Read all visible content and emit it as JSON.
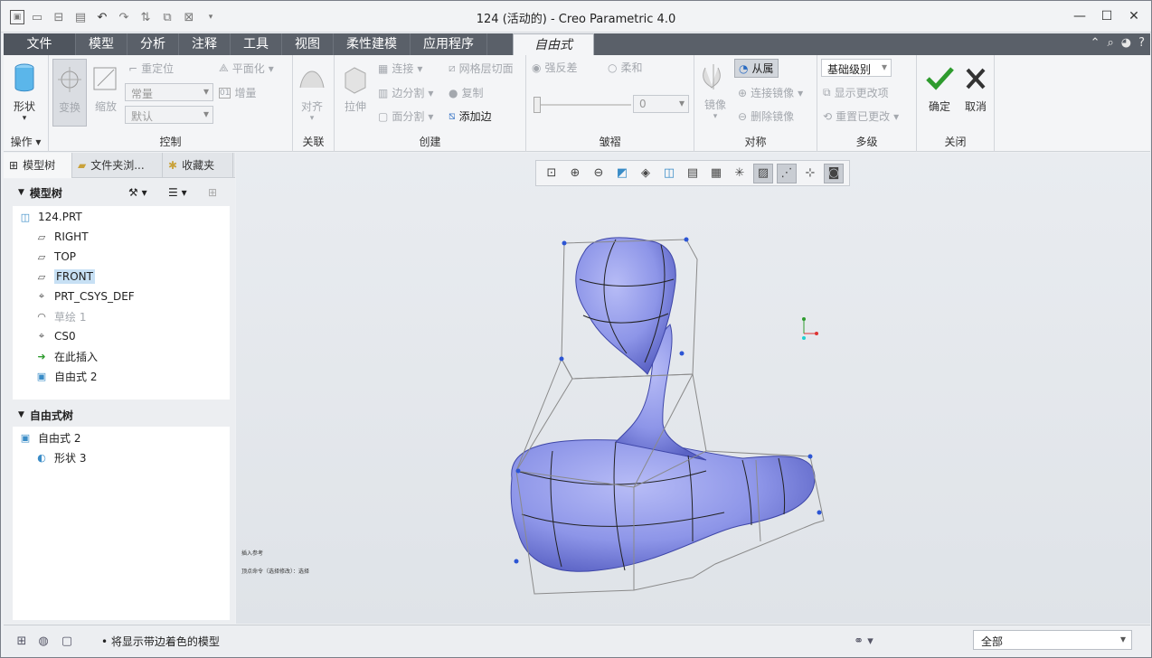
{
  "window": {
    "title": "124 (活动的) - Creo Parametric 4.0"
  },
  "menu_tabs": [
    "文件",
    "模型",
    "分析",
    "注释",
    "工具",
    "视图",
    "柔性建模",
    "应用程序"
  ],
  "active_tab": "自由式",
  "ribbon": {
    "operations": {
      "shape": "形状",
      "label": "操作"
    },
    "control": {
      "transform": "变换",
      "scale": "缩放",
      "reposition": "重定位",
      "planarize": "平面化",
      "increment": "增量",
      "combo1": "常量",
      "combo2": "默认",
      "label": "控制"
    },
    "assoc": {
      "align": "对齐",
      "label": "关联"
    },
    "create": {
      "extrude": "拉伸",
      "connect": "连接",
      "mesh_slice": "网格层切面",
      "edge_split": "边分割",
      "copy": "复制",
      "face_split": "面分割",
      "add_edge": "添加边",
      "label": "创建"
    },
    "crease": {
      "strong": "强反差",
      "soft": "柔和",
      "value": "0",
      "label": "皱褶"
    },
    "symmetry": {
      "mirror": "镜像",
      "follow": "从属",
      "connect_mirror": "连接镜像",
      "delete_mirror": "删除镜像",
      "label": "对称"
    },
    "multilevel": {
      "base": "基础级别",
      "show_changes": "显示更改项",
      "reset_changes": "重置已更改",
      "label": "多级"
    },
    "close": {
      "ok": "确定",
      "cancel": "取消",
      "label": "关闭"
    }
  },
  "panel_tabs": [
    "模型树",
    "文件夹浏...",
    "收藏夹"
  ],
  "model_tree": {
    "header": "模型树",
    "items": [
      "124.PRT",
      "RIGHT",
      "TOP",
      "FRONT",
      "PRT_CSYS_DEF",
      "草绘 1",
      "CS0",
      "在此插入",
      "自由式 2"
    ]
  },
  "freestyle_tree": {
    "header": "自由式树",
    "items": [
      "自由式 2",
      "形状 3"
    ]
  },
  "graphics_notes": [
    "插入参考",
    "顶点命令（选择修改）：选择"
  ],
  "status": {
    "message": "将显示带边着色的模型",
    "filter": "全部"
  },
  "colors": {
    "tabbar": "#5a6069",
    "model": "#8d95e8",
    "accent": "#1e6fd9"
  }
}
